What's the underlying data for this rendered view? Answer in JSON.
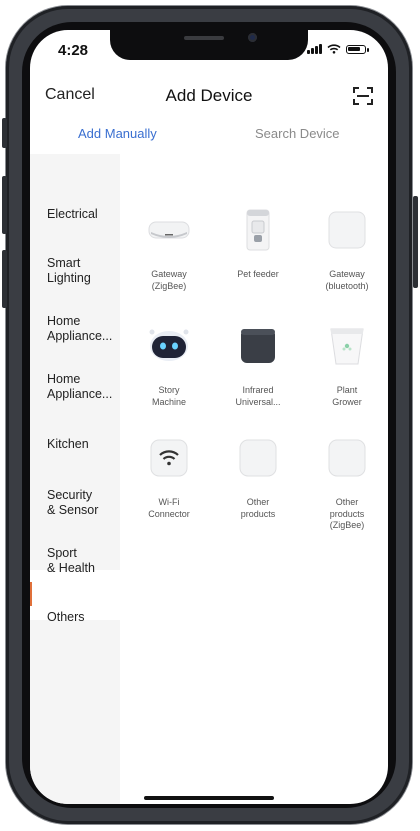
{
  "status_bar": {
    "time": "4:28"
  },
  "nav": {
    "cancel": "Cancel",
    "title": "Add Device",
    "scan_icon": "scan-icon"
  },
  "tabs": {
    "manual": "Add Manually",
    "search": "Search Device"
  },
  "sidebar": {
    "items": [
      {
        "label": "Electrical"
      },
      {
        "label": "Smart\nLighting"
      },
      {
        "label": "Home\nAppliance..."
      },
      {
        "label": "Home\nAppliance..."
      },
      {
        "label": "Kitchen"
      },
      {
        "label": "Security\n& Sensor"
      },
      {
        "label": "Sport\n& Health"
      },
      {
        "label": "Others"
      }
    ],
    "selected": "Others"
  },
  "devices": [
    {
      "label": "Gateway\n(ZigBee)",
      "icon": "gateway-icon"
    },
    {
      "label": "Pet feeder",
      "icon": "pet-feeder-icon"
    },
    {
      "label": "Gateway\n(bluetooth)",
      "icon": "gateway-bluetooth-icon"
    },
    {
      "label": "Story\nMachine",
      "icon": "story-machine-icon"
    },
    {
      "label": "Infrared\nUniversal...",
      "icon": "infrared-remote-icon"
    },
    {
      "label": "Plant\nGrower",
      "icon": "plant-grower-icon"
    },
    {
      "label": "Wi-Fi\nConnector",
      "icon": "wifi-connector-icon"
    },
    {
      "label": "Other\nproducts",
      "icon": "other-product-icon"
    },
    {
      "label": "Other\nproducts\n(ZigBee)",
      "icon": "other-product-zigbee-icon"
    }
  ],
  "colors": {
    "accent": "#3a6fd0",
    "selected_marker": "#e0703a",
    "sidebar_bg": "#f5f5f5"
  }
}
